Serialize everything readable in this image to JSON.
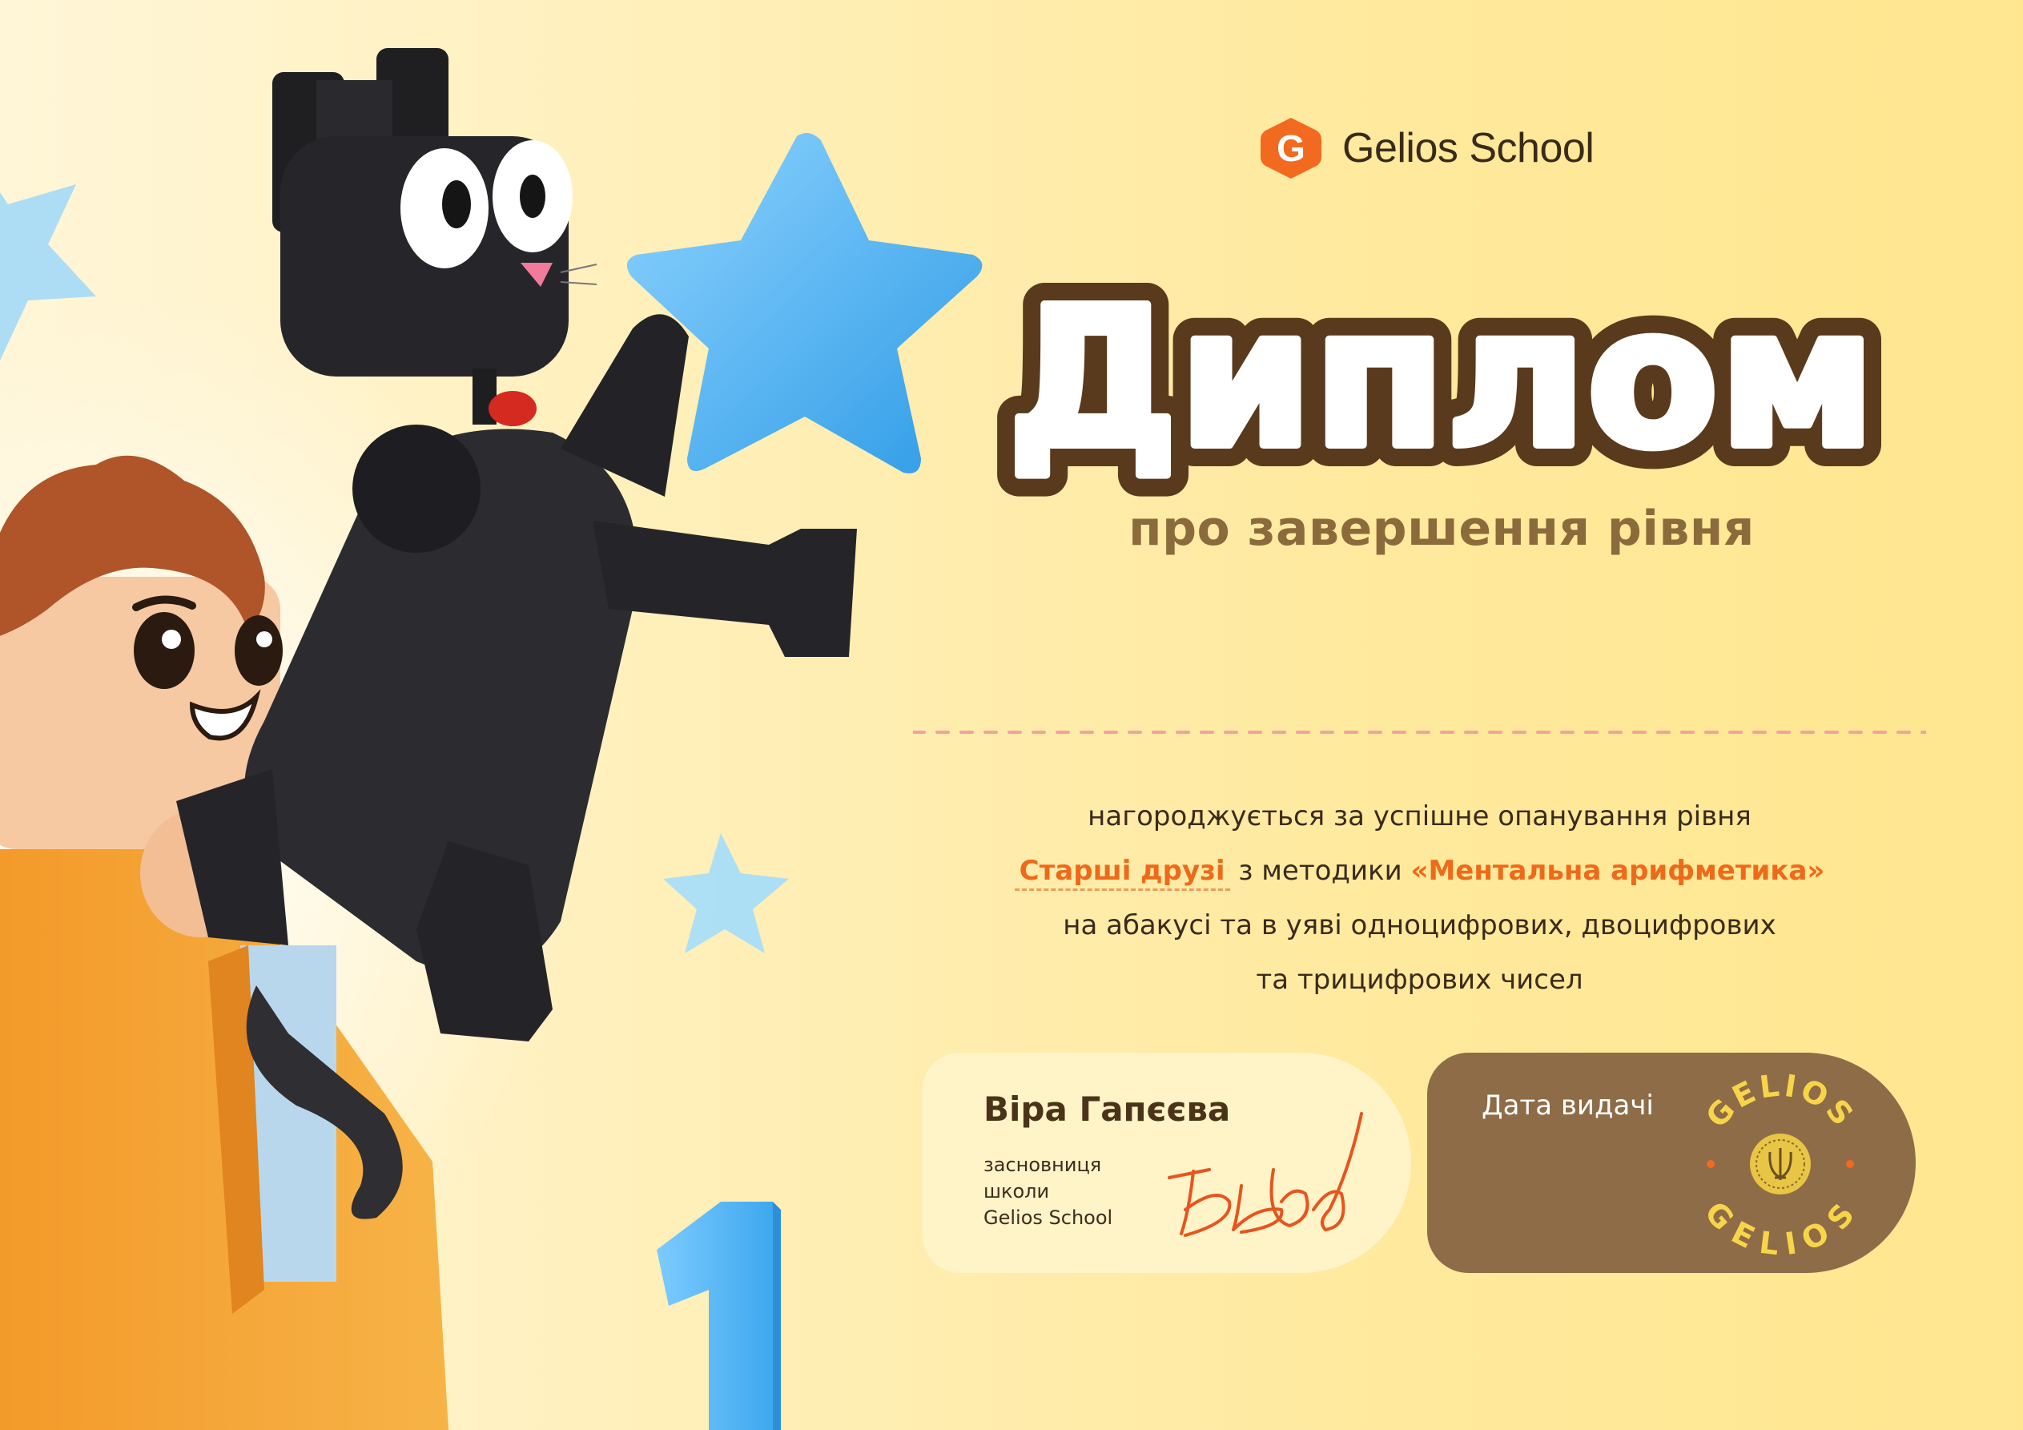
{
  "brand": {
    "name": "Gelios School",
    "logo_letter": "G",
    "logo_icon": "gelios-g-icon"
  },
  "title": "Диплом",
  "subtitle": "про завершення рівня",
  "body": {
    "line1": "нагороджується за успішне опанування рівня",
    "level_name": "Старші друзі",
    "line2_mid": " з методики ",
    "method_name": "«Ментальна арифметика»",
    "line3": "на абакусі та в уяві одноцифрових, двоцифрових",
    "line4": "та трицифрових чисел"
  },
  "signatory": {
    "name": "Віра Гапєєва",
    "role_lines": [
      "засновниця",
      "школи",
      "Gelios School"
    ]
  },
  "date": {
    "label": "Дата видачі"
  },
  "seal": {
    "text_top": "GELIOS",
    "text_bottom": "GELIOS"
  },
  "colors": {
    "accent_orange": "#EE6A1A",
    "title_brown": "#5A3A1C",
    "subtitle_brown": "#8B6A3B",
    "card_brown": "#8E6C48",
    "star_blue": "#4FB3F0",
    "seal_yellow": "#F7D548"
  },
  "illustration_icons": [
    "blue-star-icon",
    "cat-figure-icon",
    "boy-figure-icon",
    "number-one-icon"
  ]
}
